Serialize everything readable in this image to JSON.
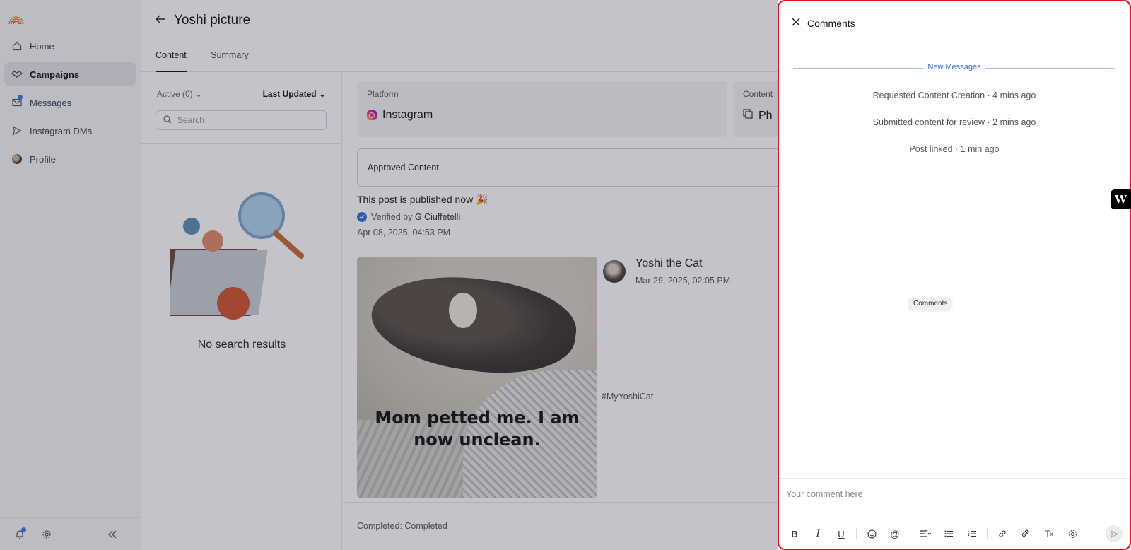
{
  "sidebar": {
    "items": [
      {
        "label": "Home",
        "icon": "home-icon"
      },
      {
        "label": "Campaigns",
        "icon": "handshake-icon",
        "active": true
      },
      {
        "label": "Messages",
        "icon": "mail-icon",
        "unread": true
      },
      {
        "label": "Instagram DMs",
        "icon": "send-icon"
      },
      {
        "label": "Profile",
        "icon": "avatar"
      }
    ]
  },
  "page": {
    "title": "Yoshi picture",
    "tabs": [
      {
        "label": "Content",
        "active": true
      },
      {
        "label": "Summary"
      }
    ]
  },
  "list": {
    "filter_label": "Active (0)",
    "sort_label": "Last Updated",
    "search_placeholder": "Search",
    "empty_text": "No search results"
  },
  "detail": {
    "platform_label": "Platform",
    "platform_value": "Instagram",
    "content_label": "Content",
    "content_value": "Ph",
    "approved_label": "Approved Content",
    "published_text": "This post is published now 🎉",
    "verified_prefix": "Verified by",
    "verified_by": "G Ciuffetelli",
    "published_date": "Apr 08, 2025, 04:53 PM",
    "photo_caption": "Mom petted me. I am now unclean.",
    "author_name": "Yoshi the Cat",
    "author_date": "Mar 29, 2025, 02:05 PM",
    "hashtag": "#MyYoshiCat",
    "completed_text": "Completed: Completed"
  },
  "comments": {
    "title": "Comments",
    "new_messages_label": "New Messages",
    "activity": [
      "Requested Content Creation · 4 mins ago",
      "Submitted content for review · 2 mins ago",
      "Post linked · 1 min ago"
    ],
    "tooltip": "Comments",
    "input_placeholder": "Your comment here",
    "toolbar": [
      "bold",
      "italic",
      "underline",
      "emoji",
      "mention",
      "align",
      "bullet-list",
      "numbered-list",
      "link",
      "attachment",
      "clear-format",
      "settings"
    ]
  },
  "colors": {
    "accent_blue": "#2f6fe0",
    "panel_border": "#d9141e",
    "notification_dot": "#2f80ed"
  },
  "badge": {
    "letter": "W"
  }
}
